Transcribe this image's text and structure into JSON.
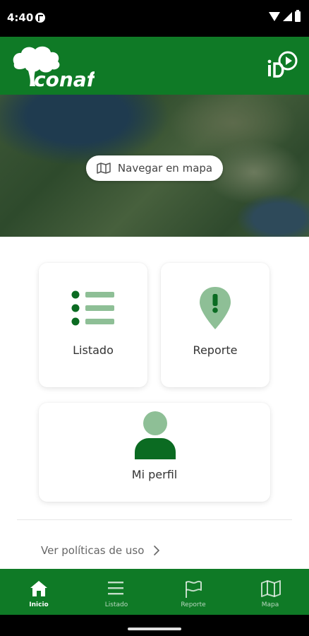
{
  "status_bar": {
    "time": "4:40"
  },
  "header": {
    "brand": "conaf"
  },
  "map_banner": {
    "button_label": "Navegar en mapa"
  },
  "cards": {
    "listado": "Listado",
    "reporte": "Reporte",
    "perfil": "Mi perfil"
  },
  "policies": {
    "label": "Ver políticas de uso"
  },
  "bottom_nav": {
    "items": [
      {
        "label": "Inicio",
        "icon": "home-icon",
        "active": true
      },
      {
        "label": "Listado",
        "icon": "menu-icon",
        "active": false
      },
      {
        "label": "Reporte",
        "icon": "flag-icon",
        "active": false
      },
      {
        "label": "Mapa",
        "icon": "map-icon",
        "active": false
      }
    ]
  },
  "colors": {
    "primary_green": "#0f7a26",
    "light_green": "#8ebf96",
    "dark_green": "#0b6b22"
  }
}
